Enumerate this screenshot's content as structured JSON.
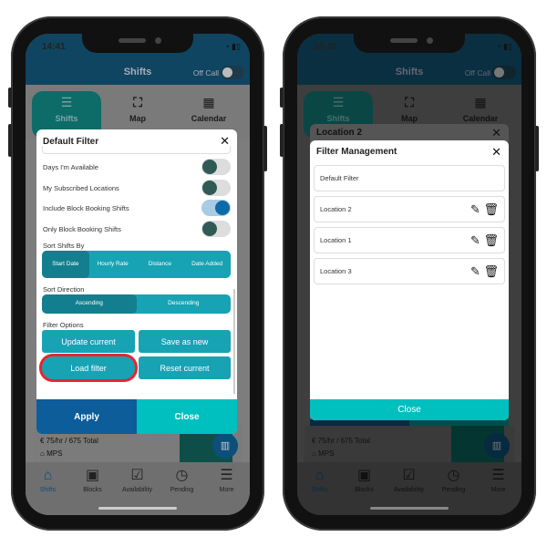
{
  "left_phone": {
    "status_time": "14:41",
    "header": {
      "title": "Shifts",
      "off_call_label": "Off Call"
    },
    "tabs": [
      {
        "label": "Shifts",
        "icon": "list-icon"
      },
      {
        "label": "Map",
        "icon": "map-icon"
      },
      {
        "label": "Calendar",
        "icon": "calendar-icon"
      }
    ],
    "modal": {
      "title": "Default Filter",
      "toggles": [
        {
          "label": "Days I'm Available",
          "on": false
        },
        {
          "label": "My Subscribed Locations",
          "on": false
        },
        {
          "label": "Include Block Booking Shifts",
          "on": true
        },
        {
          "label": "Only Block Booking Shifts",
          "on": false
        }
      ],
      "sort_by_label": "Sort Shifts By",
      "sort_by_options": [
        "Start Date",
        "Hourly Rate",
        "Distance",
        "Date Added"
      ],
      "sort_by_selected": "Start Date",
      "sort_direction_label": "Sort Direction",
      "sort_direction_options": [
        "Ascending",
        "Descending"
      ],
      "sort_direction_selected": "Ascending",
      "filter_options_label": "Filter Options",
      "buttons": {
        "update_current": "Update current",
        "save_as_new": "Save as new",
        "load_filter": "Load filter",
        "reset_current": "Reset current"
      },
      "apply": "Apply",
      "close": "Close",
      "highlight_color": "#e8262d"
    },
    "card": {
      "rate": "75/hr / 675 Total",
      "location": "MPS"
    },
    "nav": [
      {
        "label": "Shifts",
        "icon": "home-plus-icon"
      },
      {
        "label": "Blocks",
        "icon": "briefcase-icon"
      },
      {
        "label": "Availability",
        "icon": "calendar-check-icon"
      },
      {
        "label": "Pending",
        "icon": "clock-icon"
      },
      {
        "label": "More",
        "icon": "menu-icon"
      }
    ]
  },
  "right_phone": {
    "status_time": "14:42",
    "header": {
      "title": "Shifts",
      "off_call_label": "Off Call"
    },
    "tabs": [
      {
        "label": "Shifts"
      },
      {
        "label": "Map"
      },
      {
        "label": "Calendar"
      }
    ],
    "background_modal_title": "Location 2",
    "modal": {
      "title": "Filter Management",
      "items": [
        {
          "label": "Default Filter",
          "editable": false
        },
        {
          "label": "Location 2",
          "editable": true
        },
        {
          "label": "Location 1",
          "editable": true
        },
        {
          "label": "Location 3",
          "editable": true
        }
      ],
      "close": "Close"
    },
    "card": {
      "rate": "75/hr / 675 Total",
      "location": "MPS"
    },
    "nav": [
      {
        "label": "Shifts"
      },
      {
        "label": "Blocks"
      },
      {
        "label": "Availability"
      },
      {
        "label": "Pending"
      },
      {
        "label": "More"
      }
    ]
  },
  "colors": {
    "primary_blue": "#0d5d9a",
    "teal": "#00bfbf",
    "segment_teal": "#17a3b4"
  }
}
